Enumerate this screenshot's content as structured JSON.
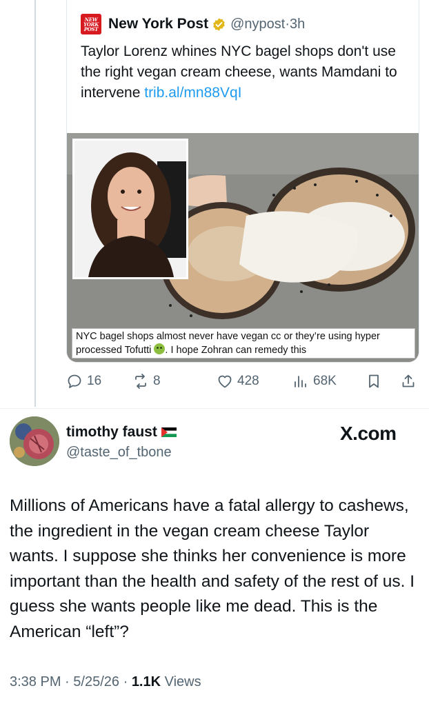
{
  "quoted_tweet": {
    "logo_text": [
      "NEW",
      "YORK",
      "POST"
    ],
    "author_name": "New York Post",
    "handle": "@nypost",
    "separator": "·",
    "time": "3h",
    "text_main": "Taylor Lorenz whines NYC bagel shops don't use the right vegan cream cheese, wants Mamdani to intervene ",
    "text_link": "trib.al/mn88VqI",
    "media_caption_part1": "NYC bagel shops almost never have vegan cc or they’re using hyper processed Tofutti ",
    "media_caption_part2": ". I hope Zohran can remedy this"
  },
  "actions": {
    "replies": "16",
    "reposts": "8",
    "likes": "428",
    "views": "68K"
  },
  "post": {
    "author_name": "timothy faust",
    "handle": "@taste_of_tbone",
    "source_logo": "X.com",
    "body": "Millions of Americans have a fatal allergy to cashews, the ingredient in the vegan cream cheese Taylor wants. I suppose she thinks her convenience is more important than the health and safety of the rest of us. I guess she wants people like me dead. This is the American “left”?",
    "time": "3:38 PM",
    "date": "5/25/26",
    "separator": "·",
    "views_count": "1.1K",
    "views_label": "Views"
  },
  "colors": {
    "link": "#1d9bf0",
    "muted": "#536471",
    "text": "#0f1419",
    "nypost_red": "#d71920",
    "verified_gold": "#e2b719"
  },
  "icons": [
    "reply-icon",
    "repost-icon",
    "like-icon",
    "views-icon",
    "bookmark-icon",
    "share-icon",
    "verified-badge-icon",
    "palestine-flag-icon"
  ]
}
